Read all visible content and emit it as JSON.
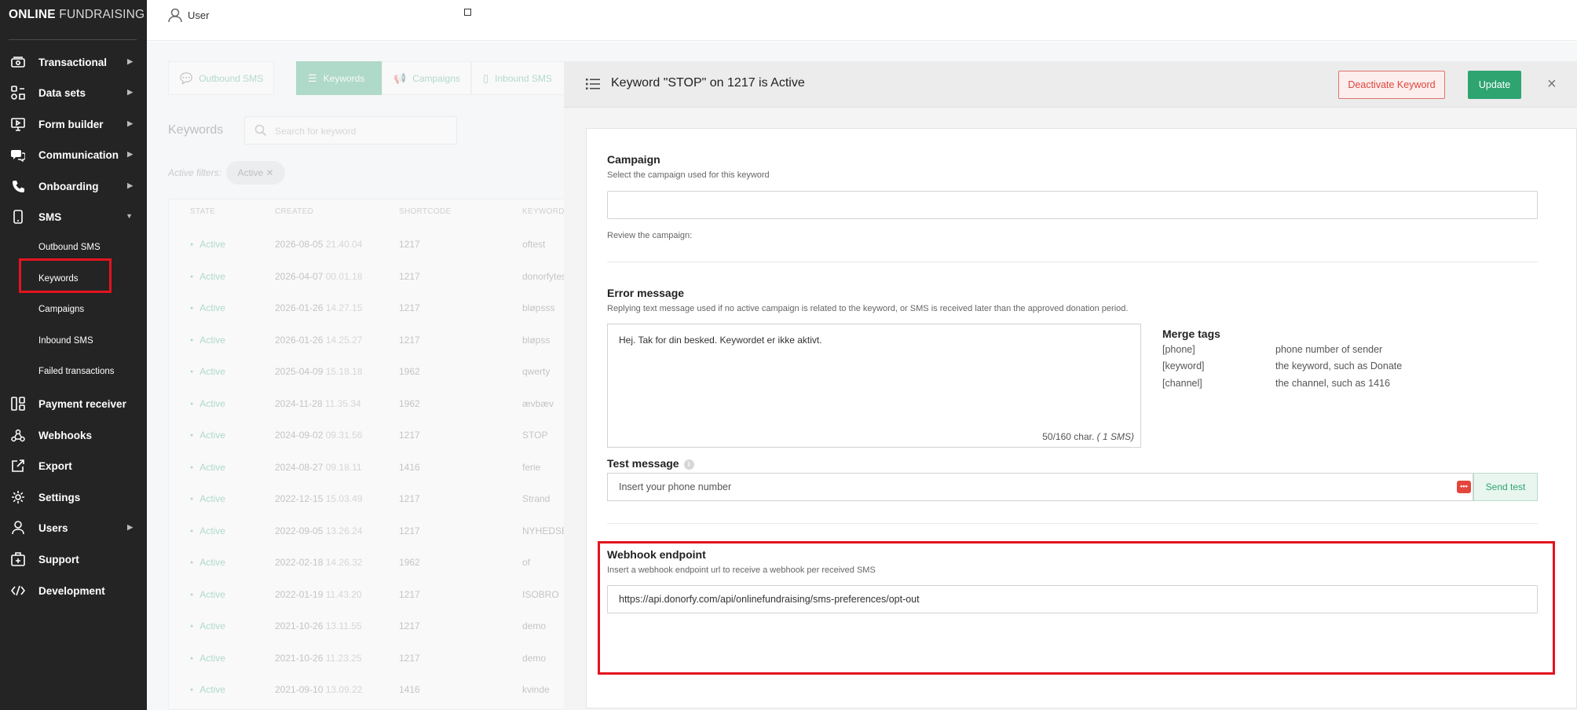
{
  "brand": {
    "bold": "ONLINE",
    "light": "FUNDRAISING"
  },
  "topbar": {
    "user_label": "User"
  },
  "sidebar": {
    "items": [
      {
        "label": "Transactional",
        "icon": "transaction-icon",
        "arrow": "▶"
      },
      {
        "label": "Data sets",
        "icon": "datasets-icon",
        "arrow": "▶"
      },
      {
        "label": "Form builder",
        "icon": "form-builder-icon",
        "arrow": "▶"
      },
      {
        "label": "Communication",
        "icon": "chat-icon",
        "arrow": "▶"
      },
      {
        "label": "Onboarding",
        "icon": "phone-icon",
        "arrow": "▶"
      },
      {
        "label": "SMS",
        "icon": "mobile-icon",
        "arrow": "▼"
      },
      {
        "label": "Payment receiver",
        "icon": "payment-receiver-icon",
        "arrow": ""
      },
      {
        "label": "Webhooks",
        "icon": "webhooks-icon",
        "arrow": ""
      },
      {
        "label": "Export",
        "icon": "export-icon",
        "arrow": ""
      },
      {
        "label": "Settings",
        "icon": "gear-icon",
        "arrow": ""
      },
      {
        "label": "Users",
        "icon": "user-icon",
        "arrow": "▶"
      },
      {
        "label": "Support",
        "icon": "support-icon",
        "arrow": ""
      },
      {
        "label": "Development",
        "icon": "code-icon",
        "arrow": ""
      }
    ],
    "sms_sub": [
      "Outbound SMS",
      "Keywords",
      "Campaigns",
      "Inbound SMS",
      "Failed transactions"
    ]
  },
  "background": {
    "tabs": [
      "Outbound SMS",
      "Keywords",
      "Campaigns",
      "Inbound SMS"
    ],
    "title": "Keywords",
    "search_placeholder": "Search for keyword",
    "active_filters_label": "Active filters:",
    "filter_chip": "Active ✕",
    "columns": [
      "STATE",
      "CREATED",
      "SHORTCODE",
      "KEYWORD"
    ],
    "rows": [
      {
        "state": "Active",
        "date": "2026-08-05",
        "time": "21.40.04",
        "shortcode": "1217",
        "keyword": "oftest"
      },
      {
        "state": "Active",
        "date": "2026-04-07",
        "time": "00.01.18",
        "shortcode": "1217",
        "keyword": "donorfytes"
      },
      {
        "state": "Active",
        "date": "2026-01-26",
        "time": "14.27.15",
        "shortcode": "1217",
        "keyword": "bløpsss"
      },
      {
        "state": "Active",
        "date": "2026-01-26",
        "time": "14.25.27",
        "shortcode": "1217",
        "keyword": "bløpss"
      },
      {
        "state": "Active",
        "date": "2025-04-09",
        "time": "15.18.18",
        "shortcode": "1962",
        "keyword": "qwerty"
      },
      {
        "state": "Active",
        "date": "2024-11-28",
        "time": "11.35.34",
        "shortcode": "1962",
        "keyword": "ævbæv"
      },
      {
        "state": "Active",
        "date": "2024-09-02",
        "time": "09.31.56",
        "shortcode": "1217",
        "keyword": "STOP"
      },
      {
        "state": "Active",
        "date": "2024-08-27",
        "time": "09.18.11",
        "shortcode": "1416",
        "keyword": "ferie"
      },
      {
        "state": "Active",
        "date": "2022-12-15",
        "time": "15.03.49",
        "shortcode": "1217",
        "keyword": "Strand"
      },
      {
        "state": "Active",
        "date": "2022-09-05",
        "time": "13.26.24",
        "shortcode": "1217",
        "keyword": "NYHEDSB"
      },
      {
        "state": "Active",
        "date": "2022-02-18",
        "time": "14.26.32",
        "shortcode": "1962",
        "keyword": "of"
      },
      {
        "state": "Active",
        "date": "2022-01-19",
        "time": "11.43.20",
        "shortcode": "1217",
        "keyword": "ISOBRO"
      },
      {
        "state": "Active",
        "date": "2021-10-26",
        "time": "13.11.55",
        "shortcode": "1217",
        "keyword": "demo"
      },
      {
        "state": "Active",
        "date": "2021-10-26",
        "time": "11.23.25",
        "shortcode": "1217",
        "keyword": "demo"
      },
      {
        "state": "Active",
        "date": "2021-09-10",
        "time": "13.09.22",
        "shortcode": "1416",
        "keyword": "kvinde"
      }
    ]
  },
  "modal": {
    "title": "Keyword \"STOP\" on 1217 is Active",
    "deactivate_label": "Deactivate Keyword",
    "update_label": "Update",
    "close": "×",
    "campaign": {
      "label": "Campaign",
      "help": "Select the campaign used for this keyword",
      "value": "",
      "review": "Review the campaign:"
    },
    "error": {
      "label": "Error message",
      "help": "Replying text message used if no active campaign is related to the keyword, or SMS is received later than the approved donation period.",
      "text": "Hej. Tak for din besked. Keywordet er ikke aktivt.",
      "counter": "50/160 char.",
      "sms_count": "( 1 SMS)"
    },
    "merge_tags": {
      "title": "Merge tags",
      "rows": [
        {
          "tag": "[phone]",
          "desc": "phone number of sender"
        },
        {
          "tag": "[keyword]",
          "desc": "the keyword, such as Donate"
        },
        {
          "tag": "[channel]",
          "desc": "the channel, such as 1416"
        }
      ]
    },
    "test": {
      "label": "Test message",
      "placeholder": "Insert your phone number",
      "send_label": "Send test"
    },
    "webhook": {
      "label": "Webhook endpoint",
      "help": "Insert a webhook endpoint url to receive a webhook per received SMS",
      "value": "https://api.donorfy.com/api/onlinefundraising/sms-preferences/opt-out"
    }
  },
  "colors": {
    "accent_green": "#2ea471",
    "danger_red": "#e3141f",
    "sidebar_bg": "#242424"
  }
}
